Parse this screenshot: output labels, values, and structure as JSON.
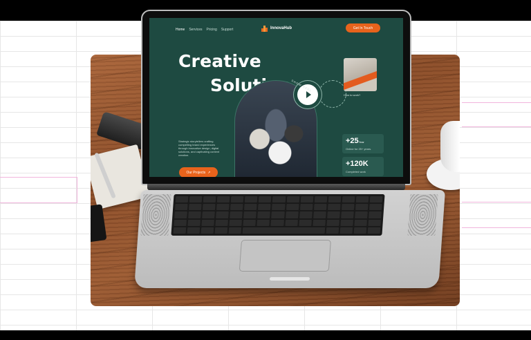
{
  "nav": {
    "links": [
      "Home",
      "Services",
      "Pricing",
      "Support"
    ],
    "brand": "InnovaHub",
    "cta": "Get In Touch"
  },
  "hero": {
    "line1": "Creative",
    "line2": "Solution",
    "description": "Strategic storytellers crafting compelling brand experiences through innovative design, digital solutions, and captivating content creation.",
    "cta": "Our Projects",
    "cta_icon": "arrow-up-right-icon",
    "showreel": "SHOW REEL"
  },
  "side": {
    "how_to": "How to work?"
  },
  "stats": [
    {
      "value": "+25",
      "unit": "Year",
      "label": "Online for 25+ years."
    },
    {
      "value": "+120K",
      "unit": "",
      "label": "Completed work"
    }
  ],
  "colors": {
    "screen_bg": "#1e4a41",
    "accent": "#e8631c",
    "card_bg": "#2a5a50"
  }
}
